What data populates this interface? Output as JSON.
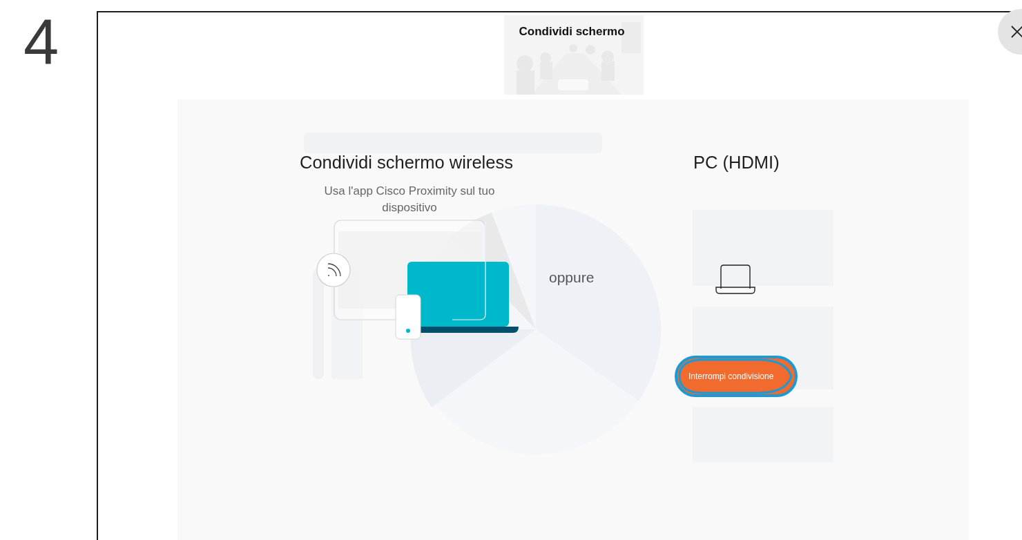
{
  "step_number": "4",
  "dialog": {
    "title": "Condividi schermo"
  },
  "wireless": {
    "title": "Condividi schermo wireless",
    "subtitle": "Usa l'app Cisco Proximity sul tuo dispositivo"
  },
  "separator": "oppure",
  "hdmi": {
    "title": "PC (HDMI)",
    "button": "Interrompi condivisione"
  }
}
